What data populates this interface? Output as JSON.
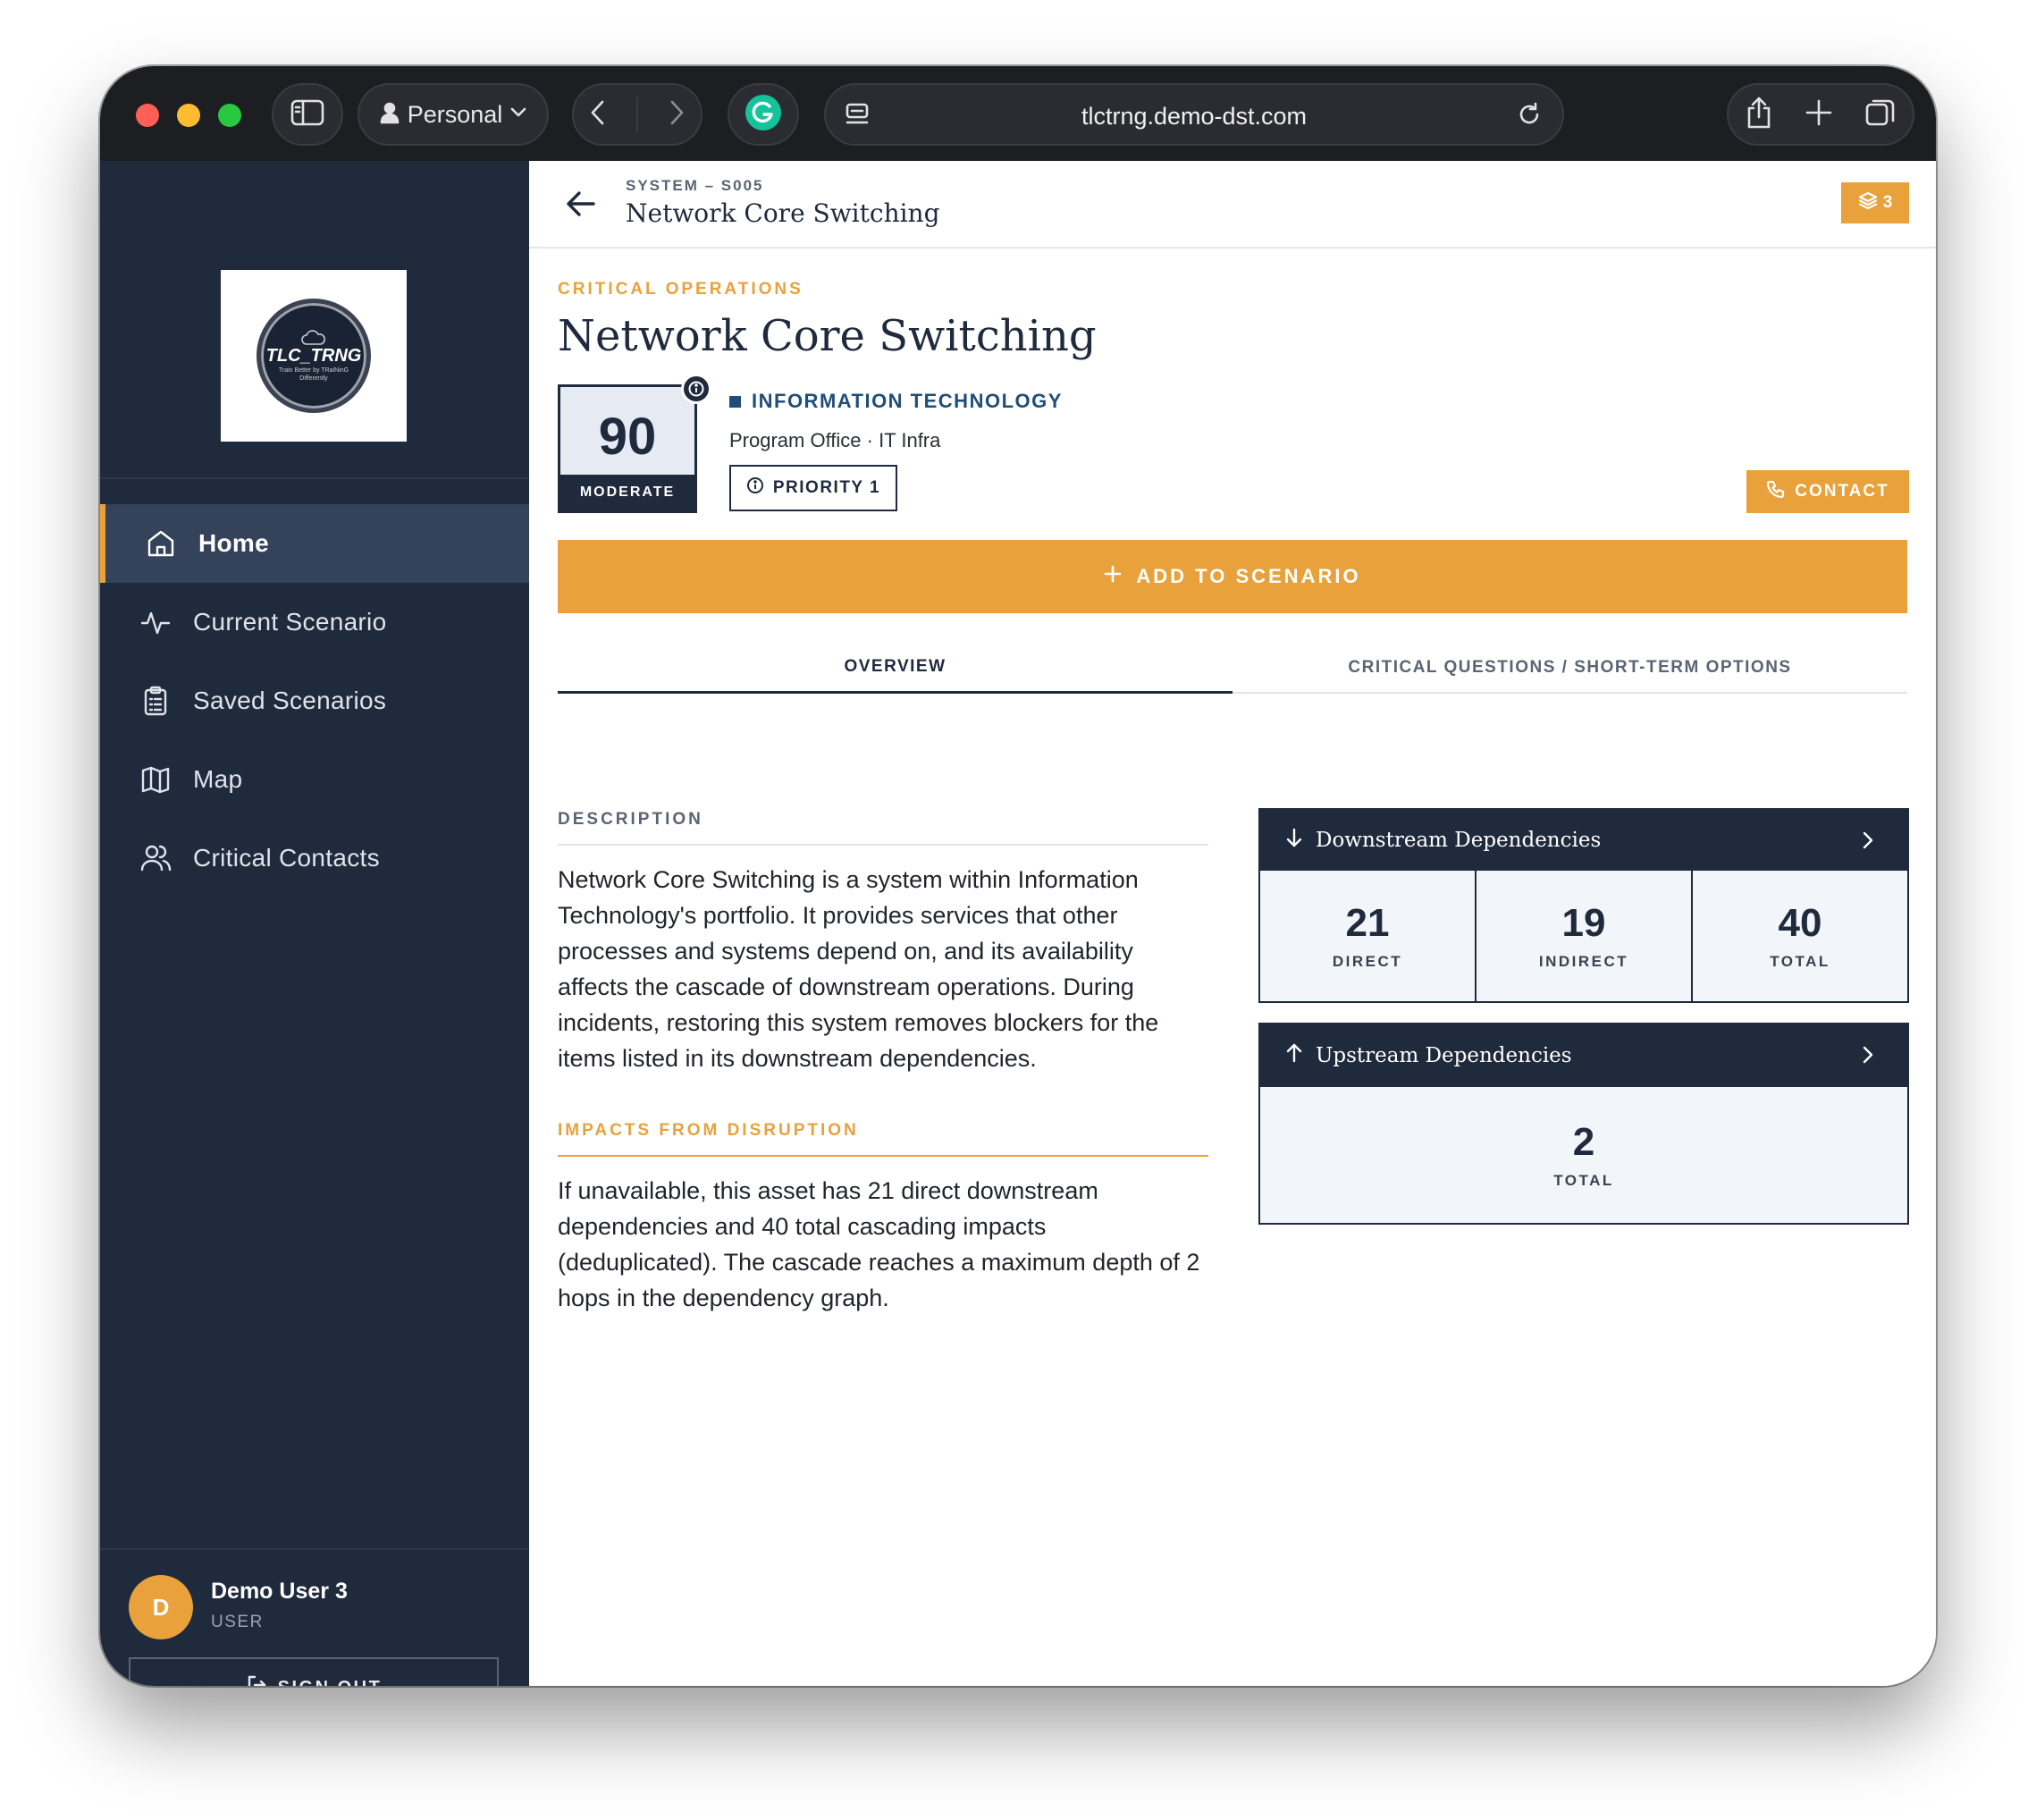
{
  "browser": {
    "profile": "Personal",
    "url": "tlctrng.demo-dst.com"
  },
  "sidebar": {
    "logo": {
      "title": "TLC_TRNG",
      "tagline": "Train Better by TRaiNinG Differently"
    },
    "nav": [
      {
        "label": "Home",
        "icon": "home-icon",
        "active": true
      },
      {
        "label": "Current Scenario",
        "icon": "activity-icon",
        "active": false
      },
      {
        "label": "Saved Scenarios",
        "icon": "clipboard-icon",
        "active": false
      },
      {
        "label": "Map",
        "icon": "map-icon",
        "active": false
      },
      {
        "label": "Critical Contacts",
        "icon": "users-icon",
        "active": false
      }
    ],
    "user": {
      "initial": "D",
      "name": "Demo User 3",
      "role": "USER"
    },
    "signout_label": "SIGN OUT"
  },
  "header": {
    "breadcrumb": "SYSTEM – S005",
    "title": "Network Core Switching",
    "scenario_count": "3"
  },
  "asset": {
    "kicker": "CRITICAL OPERATIONS",
    "title": "Network Core Switching",
    "score": "90",
    "score_label": "MODERATE",
    "department": "INFORMATION TECHNOLOGY",
    "office": "Program Office · IT Infra",
    "priority": "PRIORITY 1",
    "contact_label": "CONTACT",
    "add_label": "ADD TO SCENARIO"
  },
  "tabs": [
    {
      "label": "OVERVIEW",
      "active": true
    },
    {
      "label": "CRITICAL QUESTIONS / SHORT-TERM OPTIONS",
      "active": false
    }
  ],
  "overview": {
    "description_label": "DESCRIPTION",
    "description": "Network Core Switching is a system within Information Technology's portfolio. It provides services that other processes and systems depend on, and its availability affects the cascade of downstream operations. During incidents, restoring this system removes blockers for the items listed in its downstream dependencies.",
    "impacts_label": "IMPACTS FROM DISRUPTION",
    "impacts": "If unavailable, this asset has 21 direct downstream dependencies and 40 total cascading impacts (deduplicated). The cascade reaches a maximum depth of 2 hops in the dependency graph."
  },
  "downstream": {
    "title": "Downstream Dependencies",
    "stats": [
      {
        "value": "21",
        "label": "DIRECT"
      },
      {
        "value": "19",
        "label": "INDIRECT"
      },
      {
        "value": "40",
        "label": "TOTAL"
      }
    ]
  },
  "upstream": {
    "title": "Upstream Dependencies",
    "stats": [
      {
        "value": "2",
        "label": "TOTAL"
      }
    ]
  },
  "colors": {
    "accent": "#e9a13b",
    "navy": "#1f2a3d",
    "department": "#1f4e79"
  }
}
